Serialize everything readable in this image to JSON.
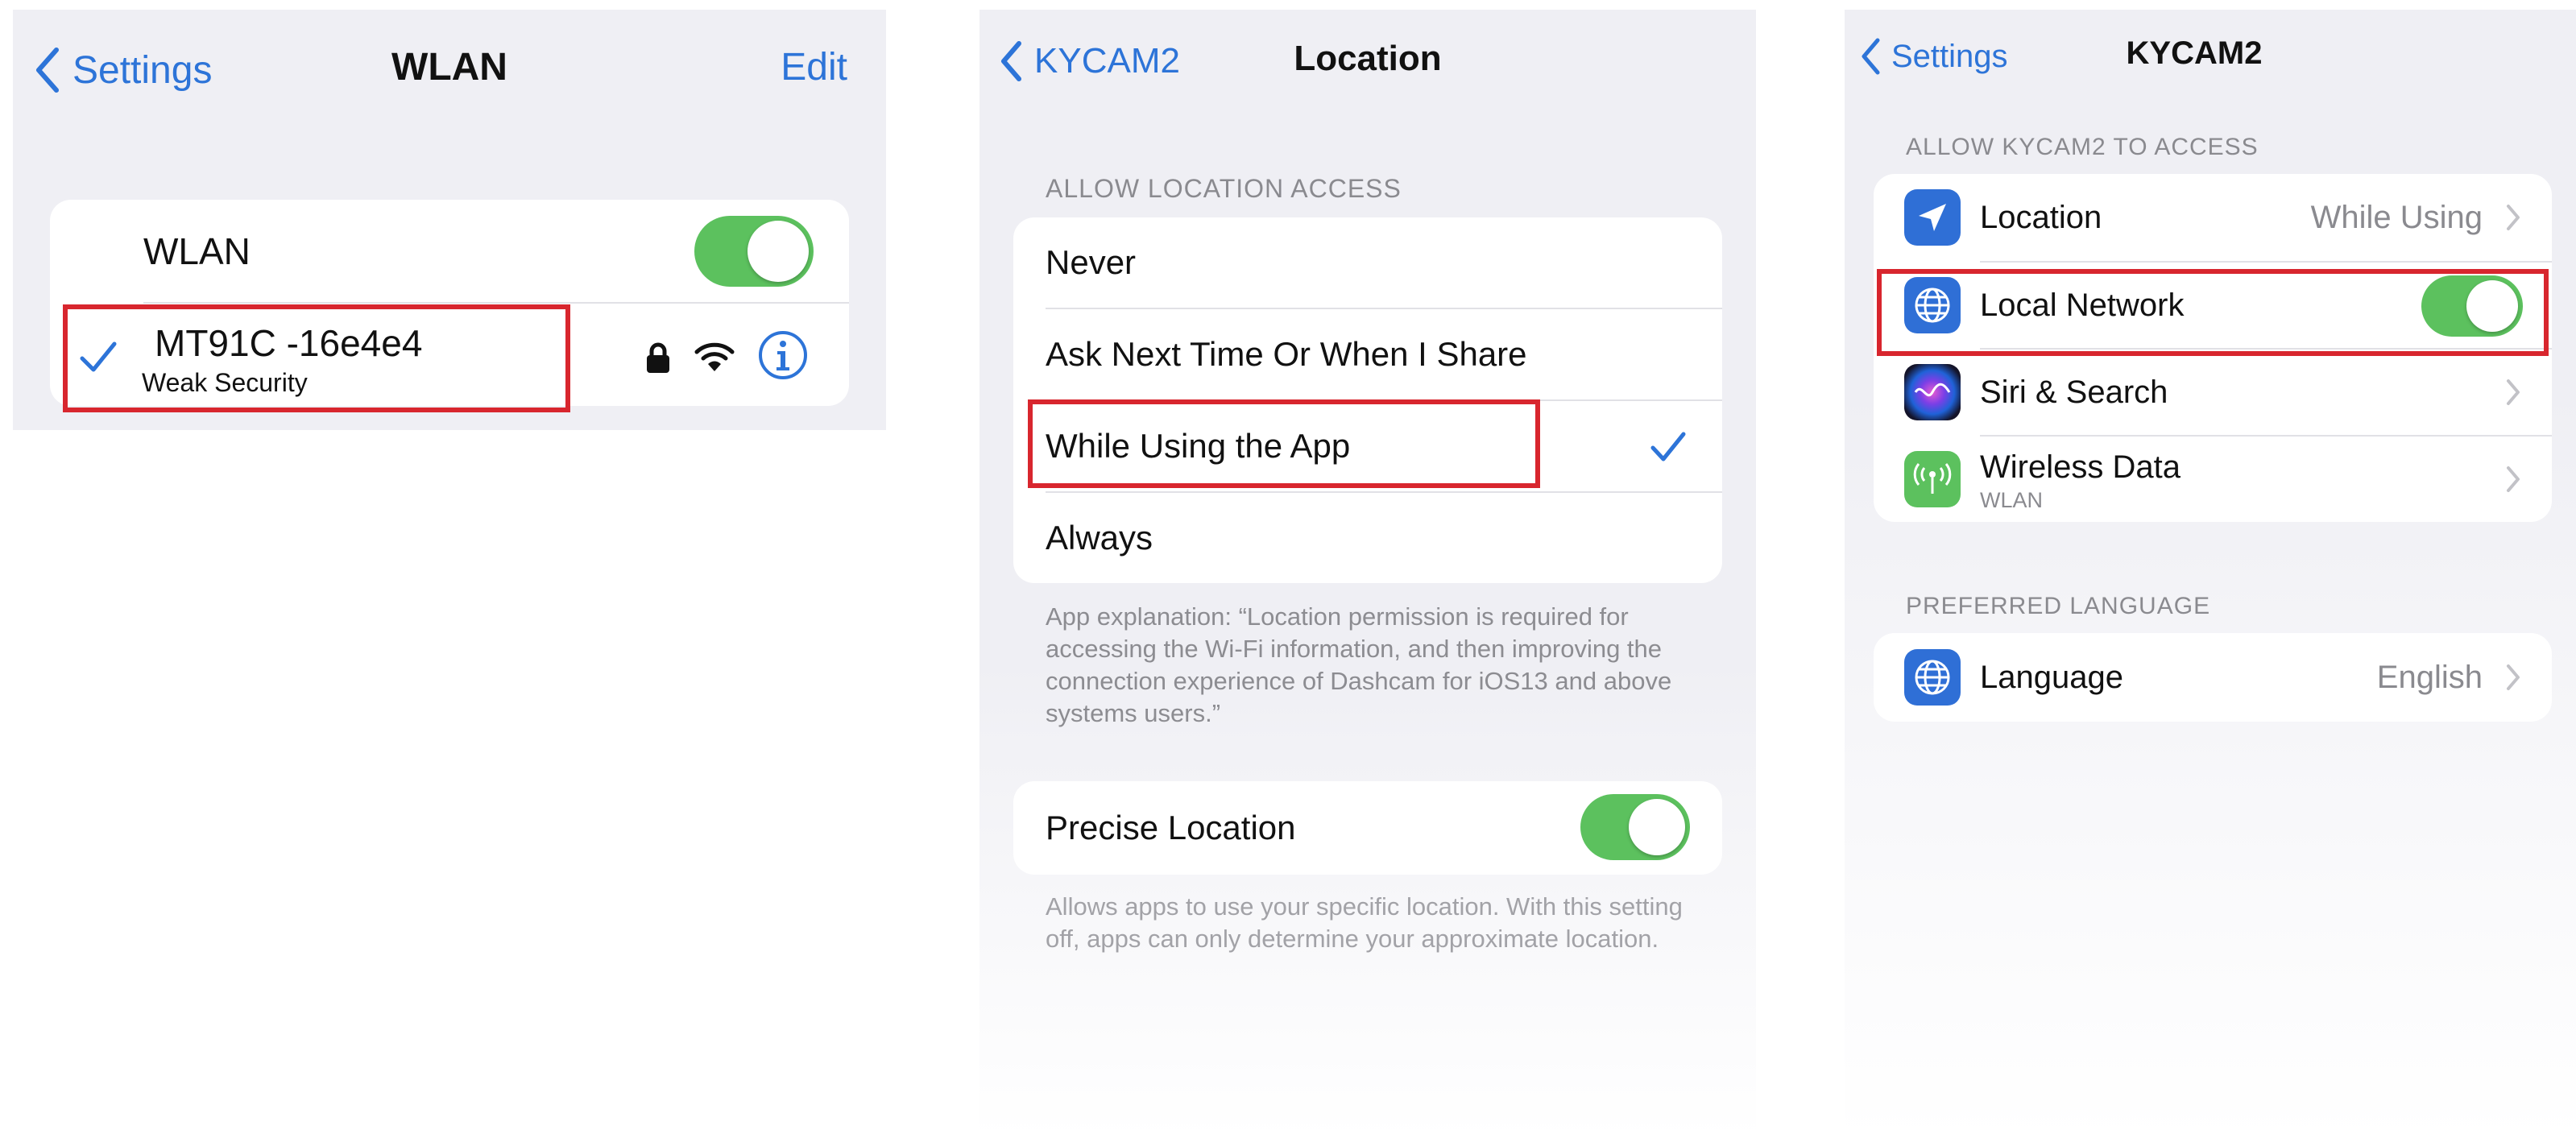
{
  "panel1": {
    "back_label": "Settings",
    "title": "WLAN",
    "edit_label": "Edit",
    "wlan_label": "WLAN",
    "wlan_toggle_on": true,
    "network": {
      "name": "MT91C -16e4e4",
      "subtitle": "Weak Security"
    }
  },
  "panel2": {
    "back_label": "KYCAM2",
    "title": "Location",
    "section_header": "ALLOW LOCATION ACCESS",
    "options": [
      "Never",
      "Ask Next Time Or When I Share",
      "While Using the App",
      "Always"
    ],
    "selected_option": "While Using the App",
    "explanation": "App explanation: “Location permission is required for accessing the Wi-Fi information, and then improving the connection experience of Dashcam for iOS13 and above systems users.”",
    "precise_label": "Precise Location",
    "precise_toggle_on": true,
    "precise_footnote": "Allows apps to use your specific location. With this setting off, apps can only determine your approximate location."
  },
  "panel3": {
    "back_label": "Settings",
    "title": "KYCAM2",
    "section_header": "ALLOW KYCAM2 TO ACCESS",
    "rows": {
      "location": {
        "label": "Location",
        "value": "While Using"
      },
      "local_network": {
        "label": "Local Network",
        "toggle_on": true
      },
      "siri": {
        "label": "Siri & Search"
      },
      "wireless": {
        "label": "Wireless Data",
        "subtitle": "WLAN"
      }
    },
    "language_header": "PREFERRED LANGUAGE",
    "language": {
      "label": "Language",
      "value": "English"
    }
  },
  "colors": {
    "accent": "#2d74d8",
    "toggle_green": "#5cc15e",
    "highlight_red": "#d8262e",
    "background": "#efeff4"
  },
  "icons": {
    "back": "chevron-left-icon",
    "checkmark": "checkmark-icon",
    "lock": "lock-icon",
    "wifi": "wifi-icon",
    "info": "info-icon",
    "location": "location-arrow-icon",
    "local_network": "globe-icon",
    "siri": "siri-icon",
    "wireless": "antenna-icon",
    "language": "globe-icon",
    "disclosure": "chevron-right-icon"
  }
}
